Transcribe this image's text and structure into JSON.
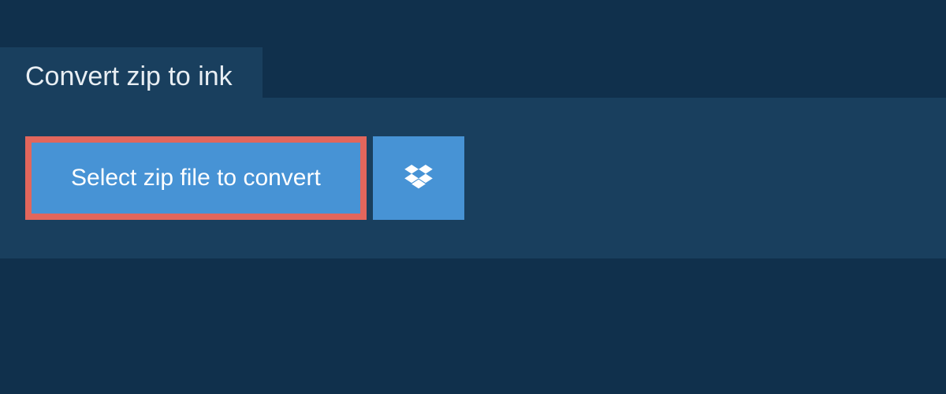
{
  "header": {
    "title": "Convert zip to ink"
  },
  "actions": {
    "select_file_label": "Select zip file to convert"
  },
  "colors": {
    "background": "#10304c",
    "panel": "#193f5e",
    "button": "#4793d5",
    "highlight_border": "#e2665c",
    "text_light": "#ffffff"
  }
}
